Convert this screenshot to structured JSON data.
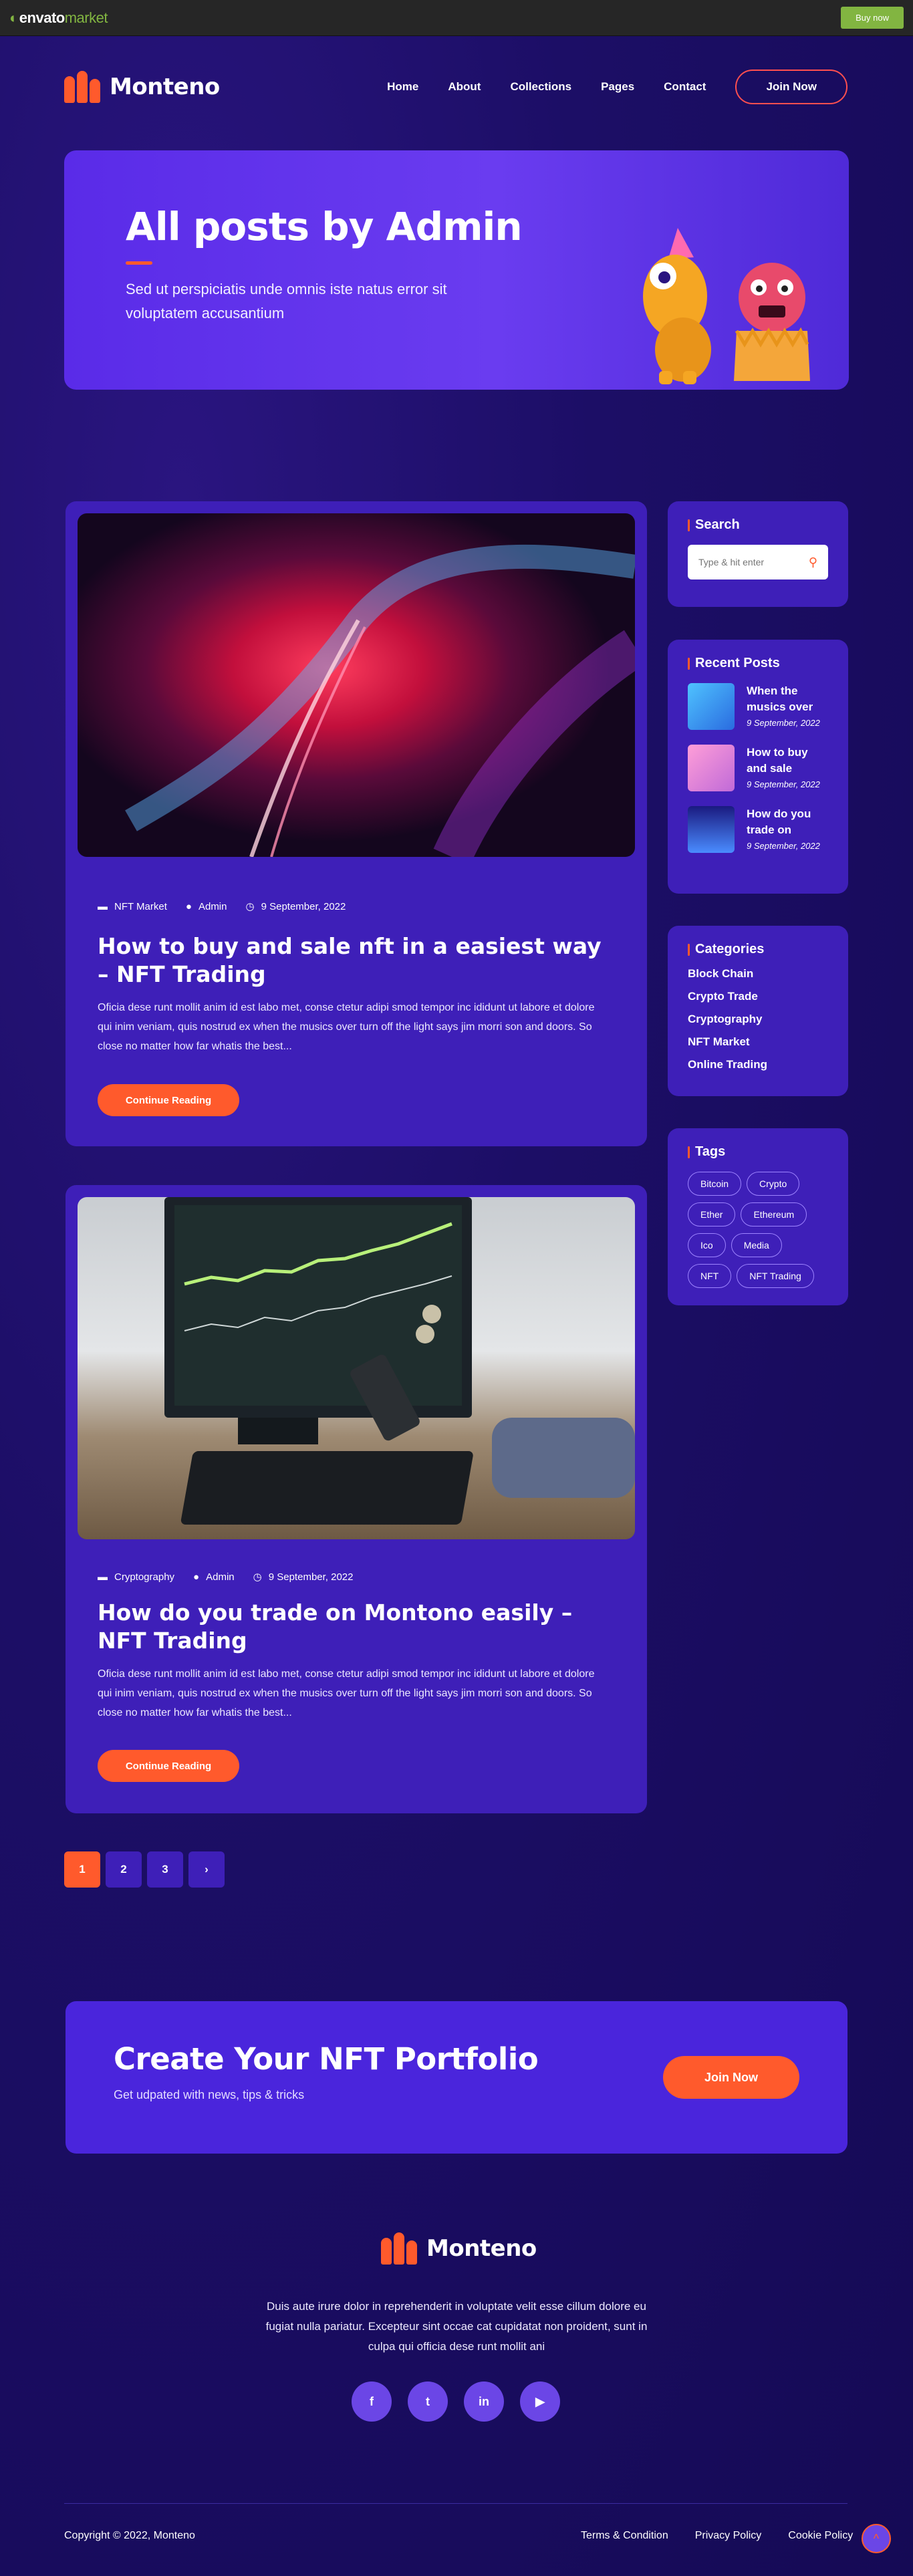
{
  "envato": {
    "logo_word": "envato",
    "logo_market": "market",
    "buy_label": "Buy now"
  },
  "site": {
    "name": "Monteno"
  },
  "nav": {
    "items": [
      "Home",
      "About",
      "Collections",
      "Pages",
      "Contact"
    ],
    "join_label": "Join Now"
  },
  "hero": {
    "title": "All posts by Admin",
    "subtitle": "Sed ut perspiciatis unde omnis iste natus error sit voluptatem accusantium"
  },
  "posts": [
    {
      "category": "NFT Market",
      "author": "Admin",
      "date": "9 September, 2022",
      "title": "How to buy and sale nft in a easiest way – NFT Trading",
      "excerpt": "Oficia dese runt mollit anim id est labo met, conse ctetur adipi smod tempor inc ididunt ut labore et dolore qui inim veniam, quis nostrud ex when the musics over turn off the light says jim morri son and doors. So close no matter how far whatis the best...",
      "button": "Continue Reading"
    },
    {
      "category": "Cryptography",
      "author": "Admin",
      "date": "9 September, 2022",
      "title": "How do you trade on Montono easily – NFT Trading",
      "excerpt": "Oficia dese runt mollit anim id est labo met, conse ctetur adipi smod tempor inc ididunt ut labore et dolore qui inim veniam, quis nostrud ex when the musics over turn off the light says jim morri son and doors. So close no matter how far whatis the best...",
      "button": "Continue Reading"
    }
  ],
  "sidebar": {
    "search": {
      "title": "Search",
      "placeholder": "Type & hit enter"
    },
    "recent": {
      "title": "Recent Posts",
      "items": [
        {
          "title": "When the musics over",
          "date": "9 September, 2022"
        },
        {
          "title": "How to buy and sale",
          "date": "9 September, 2022"
        },
        {
          "title": "How do you trade on",
          "date": "9 September, 2022"
        }
      ]
    },
    "categories": {
      "title": "Categories",
      "items": [
        "Block Chain",
        "Crypto Trade",
        "Cryptography",
        "NFT Market",
        "Online Trading"
      ]
    },
    "tags": {
      "title": "Tags",
      "items": [
        "Bitcoin",
        "Crypto",
        "Ether",
        "Ethereum",
        "Ico",
        "Media",
        "NFT",
        "NFT Trading"
      ]
    }
  },
  "pagination": {
    "pages": [
      "1",
      "2",
      "3"
    ],
    "next": "›",
    "current": 1
  },
  "cta": {
    "title": "Create Your NFT Portfolio",
    "subtitle": "Get udpated with news, tips & tricks",
    "button": "Join Now"
  },
  "footer": {
    "about": "Duis aute irure dolor in reprehenderit in voluptate velit esse cillum dolore eu fugiat nulla pariatur. Excepteur sint occae cat cupidatat non proident, sunt in culpa qui officia dese runt mollit ani",
    "socials": [
      "facebook-icon",
      "twitter-icon",
      "linkedin-icon",
      "youtube-icon"
    ],
    "social_glyphs": [
      "f",
      "t",
      "in",
      "▶"
    ],
    "copyright": "Copyright © 2022, Monteno",
    "links": [
      "Terms & Condition",
      "Privacy Policy",
      "Cookie Policy"
    ],
    "to_top": "^"
  },
  "colors": {
    "accent": "#ff5a2c",
    "card": "#3e1fb8",
    "envato_green": "#82b541"
  }
}
